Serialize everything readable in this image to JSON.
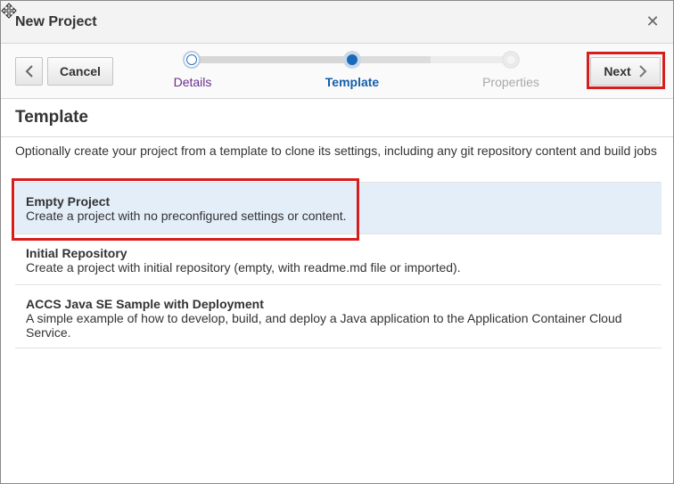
{
  "dialog": {
    "title": "New Project",
    "close_icon": "close-icon"
  },
  "toolbar": {
    "back_icon": "chevron-left-icon",
    "cancel_label": "Cancel",
    "next_label": "Next",
    "next_icon": "chevron-right-icon"
  },
  "train": {
    "steps": [
      {
        "label": "Details",
        "state": "visited"
      },
      {
        "label": "Template",
        "state": "current"
      },
      {
        "label": "Properties",
        "state": "future"
      }
    ]
  },
  "content": {
    "title": "Template",
    "intro": "Optionally create your project from a template to clone its settings, including any git repository content and build jobs",
    "templates": [
      {
        "title": "Empty Project",
        "description": "Create a project with no preconfigured settings or content.",
        "selected": true
      },
      {
        "title": "Initial Repository",
        "description": "Create a project with initial repository (empty, with readme.md file or imported).",
        "selected": false
      },
      {
        "title": "ACCS Java SE Sample with Deployment",
        "description": "A simple example of how to develop, build, and deploy a Java application to the Application Container Cloud Service.",
        "selected": false
      }
    ]
  },
  "colors": {
    "highlight": "#d51f1f",
    "selected_row": "#e4eef8",
    "current_step": "#145fa8",
    "visited_step": "#6a2e8f",
    "future_step": "#a9a9a9"
  }
}
